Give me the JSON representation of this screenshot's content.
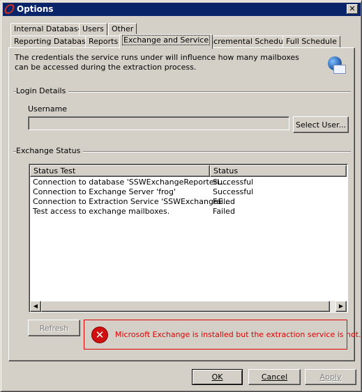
{
  "window": {
    "title": "Options",
    "close": "✕"
  },
  "tabs": {
    "row1": [
      "Internal Database",
      "Users",
      "Other"
    ],
    "row2": [
      "Reporting Database",
      "Reports",
      "Exchange and Service",
      "Incremental Schedule",
      "Full Schedule"
    ],
    "active": "Exchange and Service"
  },
  "description": "The credentials the service runs under will influence how many mailboxes can be accessed during the extraction process.",
  "login": {
    "group": "Login Details",
    "username_label": "Username",
    "username_value": "",
    "select_user": "Select User..."
  },
  "status": {
    "group": "Exchange Status",
    "columns": [
      "Status Test",
      "Status"
    ],
    "rows": [
      [
        "Connection to database 'SSWExchangeReporterL...",
        "Successful"
      ],
      [
        "Connection to Exchange Server 'frog'",
        "Successful"
      ],
      [
        "Connection to Extraction Service 'SSWExchangeE...",
        "Failed"
      ],
      [
        "Test access to exchange mailboxes.",
        "Failed"
      ]
    ]
  },
  "refresh": "Refresh",
  "error": {
    "message": "Microsoft Exchange is installed but the extraction service is not.",
    "color": "#e00000",
    "icon": "error-x-icon"
  },
  "buttons": {
    "ok": "OK",
    "cancel": "Cancel",
    "apply": "Apply"
  }
}
